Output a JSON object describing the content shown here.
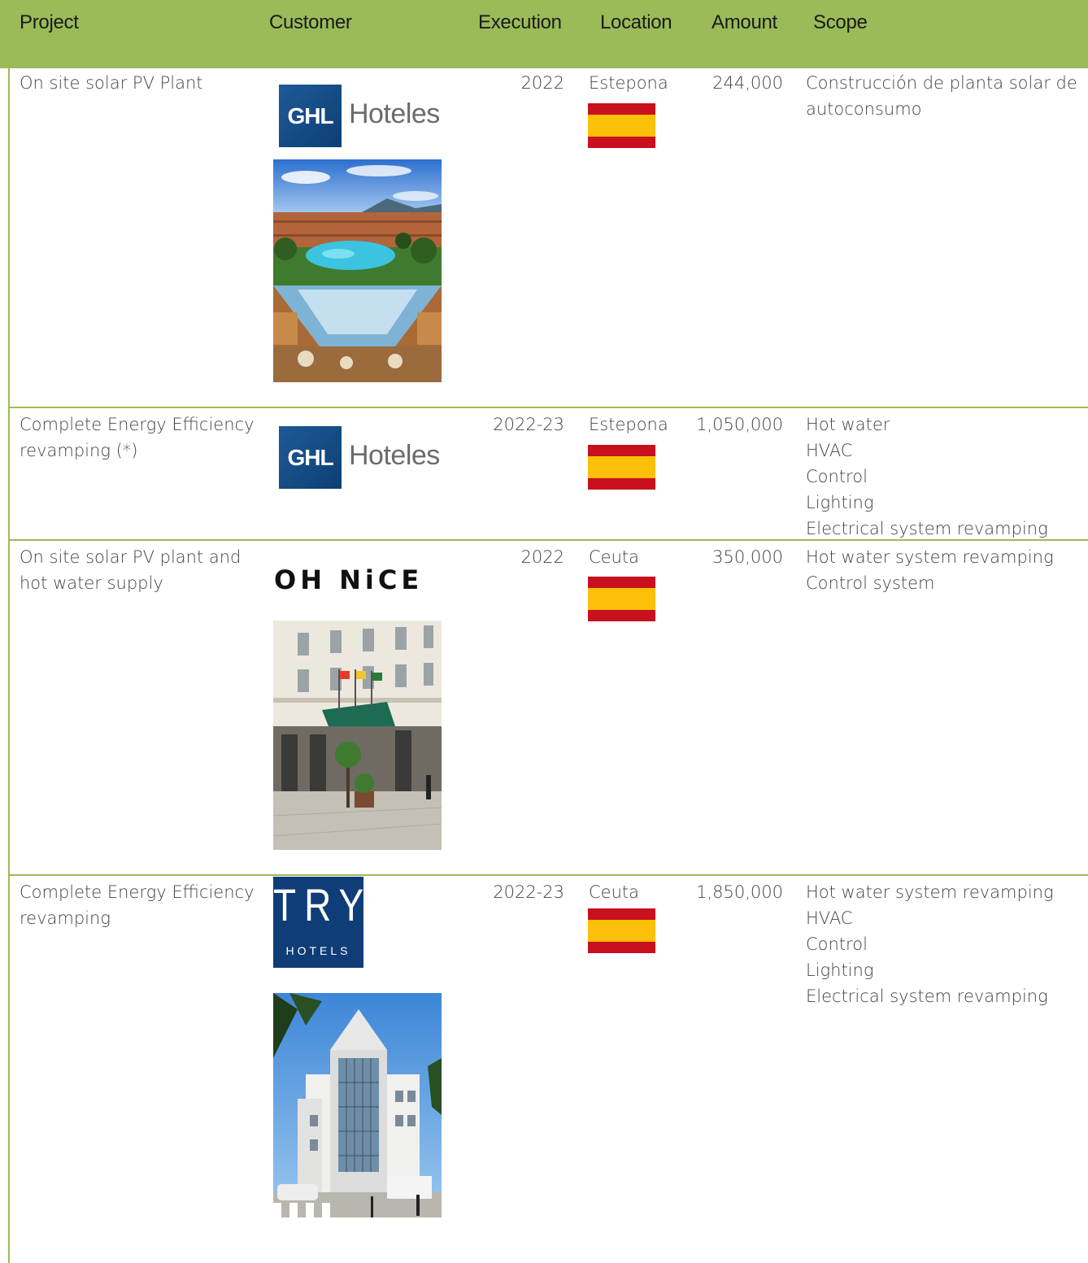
{
  "header": {
    "project": "Project",
    "customer": "Customer",
    "execution": "Execution",
    "location": "Location",
    "amount": "Amount",
    "scope": "Scope"
  },
  "rows": [
    {
      "project": "On site solar PV Plant",
      "customer_logo": "GHL Hoteles",
      "logo_parts": {
        "box": "GHL",
        "text": "Hoteles"
      },
      "execution": "2022",
      "location": "Estepona",
      "flag": "spain-flag",
      "amount": "244,000",
      "scope": [
        "Construcción de planta solar de",
        "autoconsumo"
      ]
    },
    {
      "project": "Complete Energy Efficiency revamping (*)",
      "customer_logo": "GHL Hoteles",
      "logo_parts": {
        "box": "GHL",
        "text": "Hoteles"
      },
      "execution": "2022-23",
      "location": "Estepona",
      "flag": "spain-flag",
      "amount": "1,050,000",
      "scope": [
        "Hot water",
        "HVAC",
        "Control",
        "Lighting",
        "Electrical system revamping"
      ]
    },
    {
      "project": "On site solar PV plant and hot water supply",
      "customer_logo": "OH NICE",
      "logo_parts": {
        "text": "OH NiCE"
      },
      "execution": "2022",
      "location": "Ceuta",
      "flag": "spain-flag",
      "amount": "350,000",
      "scope": [
        "Hot water system revamping",
        "Control system"
      ]
    },
    {
      "project": "Complete Energy Efficiency revamping",
      "customer_logo": "TRYP HOTELS",
      "logo_parts": {
        "big": "TRYP",
        "small": "HOTELS"
      },
      "execution": "2022-23",
      "location": "Ceuta",
      "flag": "spain-flag",
      "amount": "1,850,000",
      "scope": [
        "Hot water system revamping",
        "HVAC",
        "Control",
        "Lighting",
        "Electrical system revamping"
      ]
    }
  ],
  "colors": {
    "header_bg": "#9bbb59",
    "flag_red": "#c8101e",
    "flag_yellow": "#fcbf0a",
    "logo_blue": "#0f3d77"
  }
}
